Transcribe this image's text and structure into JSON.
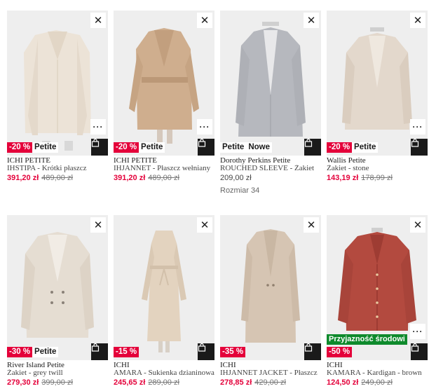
{
  "icons": {
    "close": "close-icon",
    "more": "more-options-icon",
    "bag": "shopping-bag-icon"
  },
  "colors": {
    "discount": "#e4003a",
    "sustainability": "#0e8a2c",
    "dark": "#1a1a1a"
  },
  "products": [
    {
      "brand": "ICHI PETITE",
      "name": "IHSTIPA - Krótki płaszcz",
      "price": "391,20 zł",
      "old_price": "489,00 zł",
      "discount": "-20 %",
      "tag": "Petite",
      "tag2": "",
      "green_tag": "",
      "size": ""
    },
    {
      "brand": "ICHI PETITE",
      "name": "IHJANNET - Płaszcz wełniany",
      "price": "391,20 zł",
      "old_price": "489,00 zł",
      "discount": "-20 %",
      "tag": "Petite",
      "tag2": "",
      "green_tag": "",
      "size": ""
    },
    {
      "brand": "Dorothy Perkins Petite",
      "name": "ROUCHED SLEEVE - Żakiet",
      "price": "209,00 zł",
      "old_price": "",
      "discount": "",
      "tag": "Petite",
      "tag2": "Nowe",
      "green_tag": "",
      "size": "Rozmiar 34"
    },
    {
      "brand": "Wallis Petite",
      "name": "Żakiet - stone",
      "price": "143,19 zł",
      "old_price": "178,99 zł",
      "discount": "-20 %",
      "tag": "Petite",
      "tag2": "",
      "green_tag": "",
      "size": ""
    },
    {
      "brand": "River Island Petite",
      "name": "Żakiet - grey twill",
      "price": "279,30 zł",
      "old_price": "399,00 zł",
      "discount": "-30 %",
      "tag": "Petite",
      "tag2": "",
      "green_tag": "",
      "size": ""
    },
    {
      "brand": "ICHI",
      "name": "AMARA - Sukienka dzianinowa",
      "price": "245,65 zł",
      "old_price": "289,00 zł",
      "discount": "-15 %",
      "tag": "",
      "tag2": "",
      "green_tag": "",
      "size": ""
    },
    {
      "brand": "ICHI",
      "name": "IHJANNET JACKET - Płaszcz",
      "price": "278,85 zł",
      "old_price": "429,00 zł",
      "discount": "-35 %",
      "tag": "",
      "tag2": "",
      "green_tag": "",
      "size": ""
    },
    {
      "brand": "ICHI",
      "name": "KAMARA - Kardigan - brown",
      "price": "124,50 zł",
      "old_price": "249,00 zł",
      "discount": "-50 %",
      "tag": "",
      "tag2": "",
      "green_tag": "Przyjazność środowi",
      "size": ""
    }
  ]
}
